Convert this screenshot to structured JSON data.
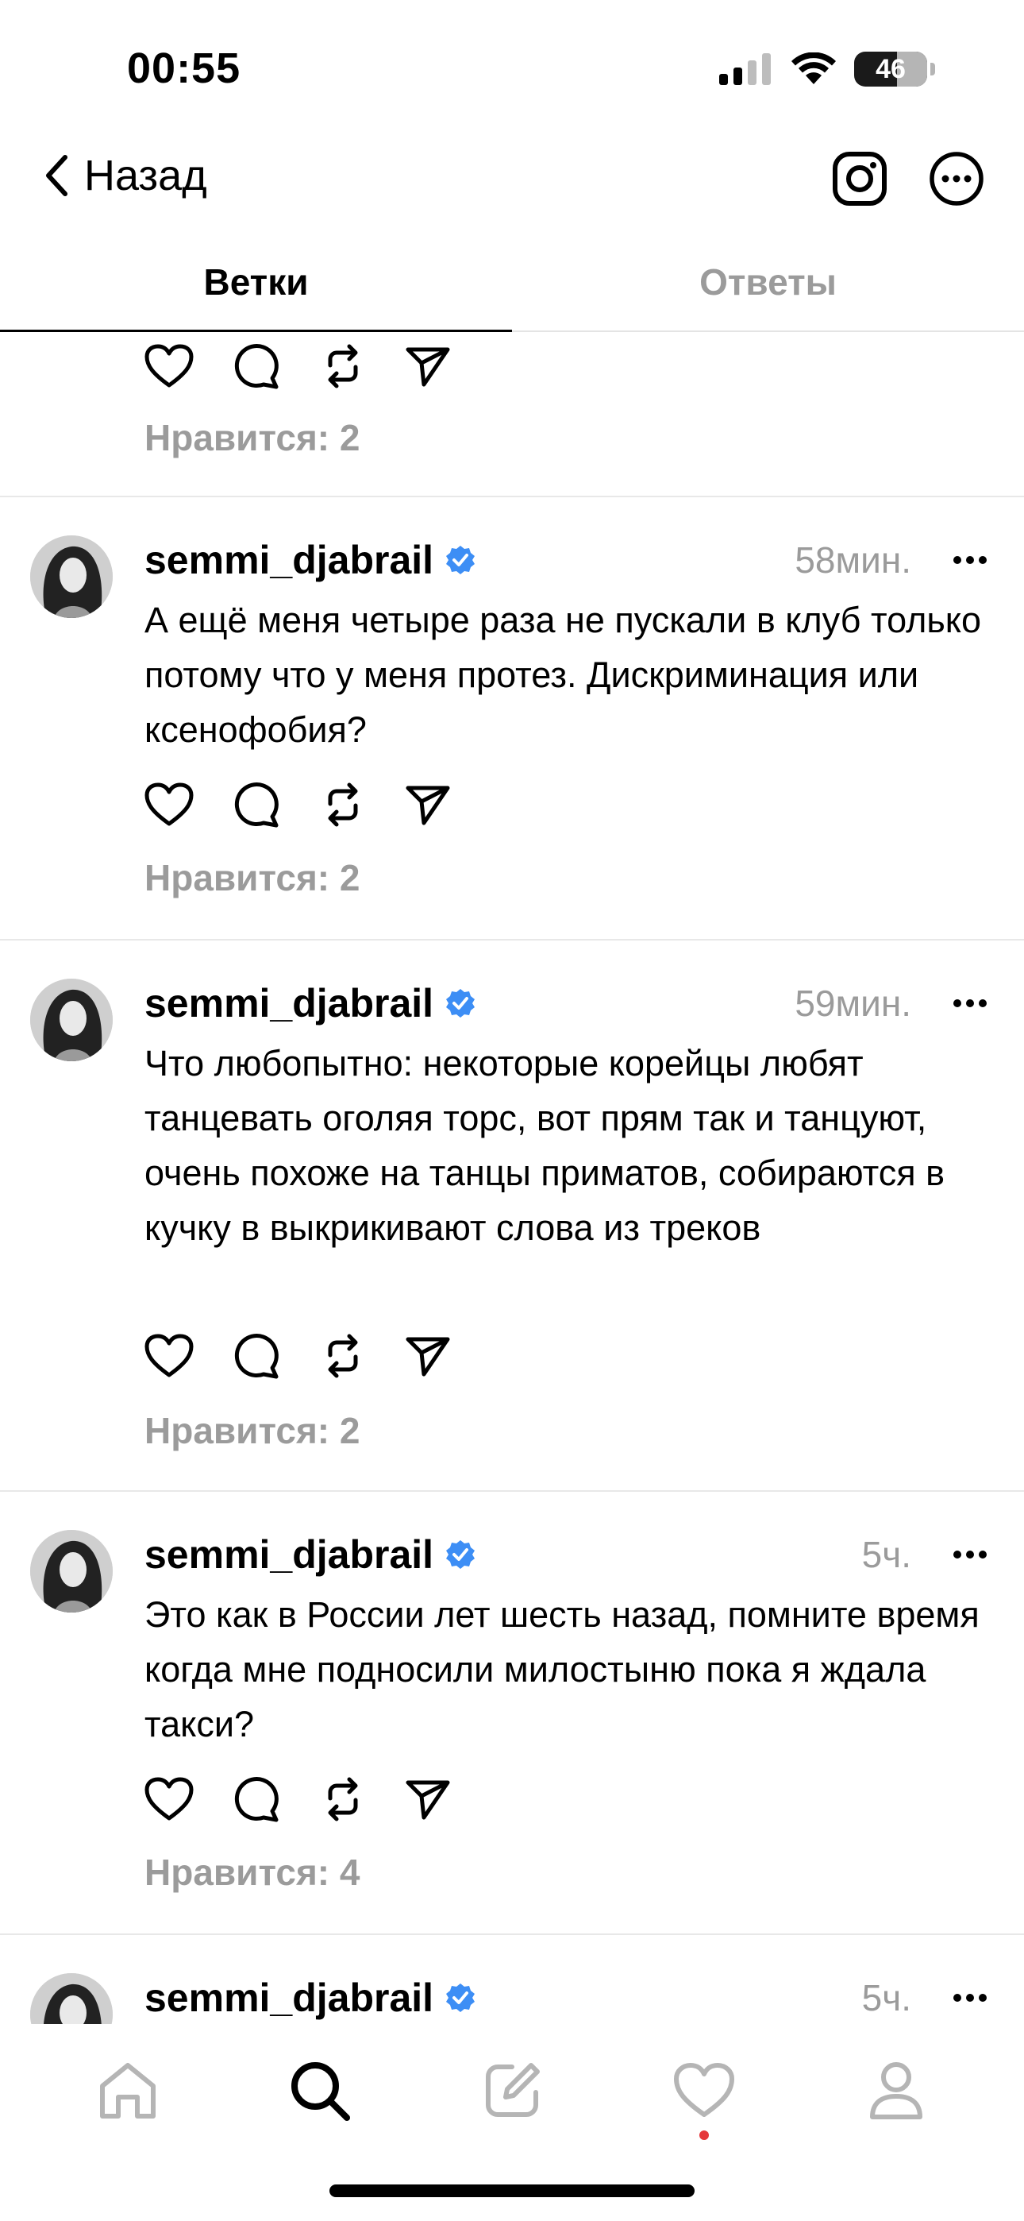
{
  "status_bar": {
    "time": "00:55",
    "battery": "46"
  },
  "header": {
    "back_label": "Назад"
  },
  "tabs": [
    {
      "label": "Ветки",
      "active": true
    },
    {
      "label": "Ответы",
      "active": false
    }
  ],
  "partial_post": {
    "likes": "Нравится: 2"
  },
  "posts": [
    {
      "username": "semmi_djabrail",
      "time": "58мин.",
      "text": "А ещё меня четыре раза не пускали в клуб только потому что у меня протез. Дискриминация или ксенофобия?",
      "likes": "Нравится: 2"
    },
    {
      "username": "semmi_djabrail",
      "time": "59мин.",
      "text": "Что любопытно: некоторые корейцы любят танцевать оголяя торс, вот прям так и танцуют, очень похоже на танцы приматов, собираются в кучку в выкрикивают слова из треков",
      "likes": "Нравится: 2"
    },
    {
      "username": "semmi_djabrail",
      "time": "5ч.",
      "text": "Это как в России лет шесть назад, помните время когда мне подносили милостыню пока я ждала такси?",
      "likes": "Нравится: 4"
    },
    {
      "username": "semmi_djabrail",
      "time": "5ч."
    }
  ],
  "bottom_nav": [
    "home-icon",
    "search-icon",
    "compose-icon",
    "activity-icon",
    "profile-icon"
  ]
}
